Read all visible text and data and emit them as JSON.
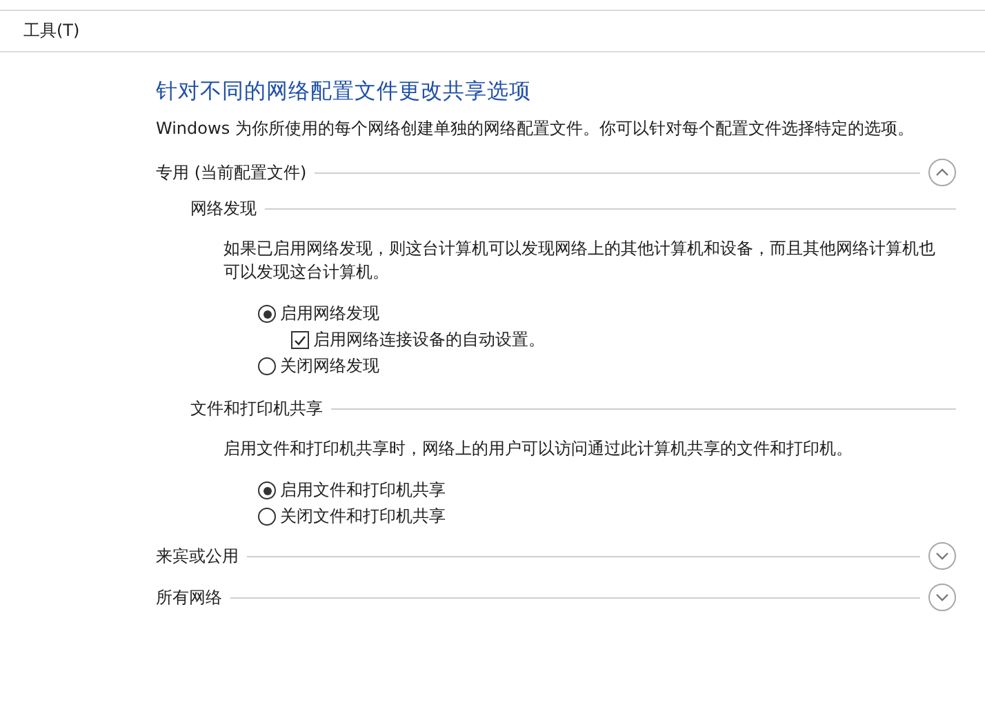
{
  "menu": [
    {
      "label": "工具(T)"
    }
  ],
  "title": "针对不同的网络配置文件更改共享选项",
  "description": "Windows 为你所使用的每个网络创建单独的网络配置文件。你可以针对每个配置文件选择特定的选项。",
  "profiles": [
    {
      "name": "专用 (当前配置文件)",
      "expanded": true,
      "groups": [
        {
          "name": "网络发现",
          "description": "如果已启用网络发现，则这台计算机可以发现网络上的其他计算机和设备，而且其他网络计算机也可以发现这台计算机。",
          "options": [
            {
              "kind": "radio",
              "label": "启用网络发现",
              "selected": true,
              "children": [
                {
                  "kind": "checkbox",
                  "label": "启用网络连接设备的自动设置。",
                  "checked": true
                }
              ]
            },
            {
              "kind": "radio",
              "label": "关闭网络发现",
              "selected": false
            }
          ]
        },
        {
          "name": "文件和打印机共享",
          "description": "启用文件和打印机共享时，网络上的用户可以访问通过此计算机共享的文件和打印机。",
          "options": [
            {
              "kind": "radio",
              "label": "启用文件和打印机共享",
              "selected": true
            },
            {
              "kind": "radio",
              "label": "关闭文件和打印机共享",
              "selected": false
            }
          ]
        }
      ]
    },
    {
      "name": "来宾或公用",
      "expanded": false
    },
    {
      "name": "所有网络",
      "expanded": false
    }
  ]
}
